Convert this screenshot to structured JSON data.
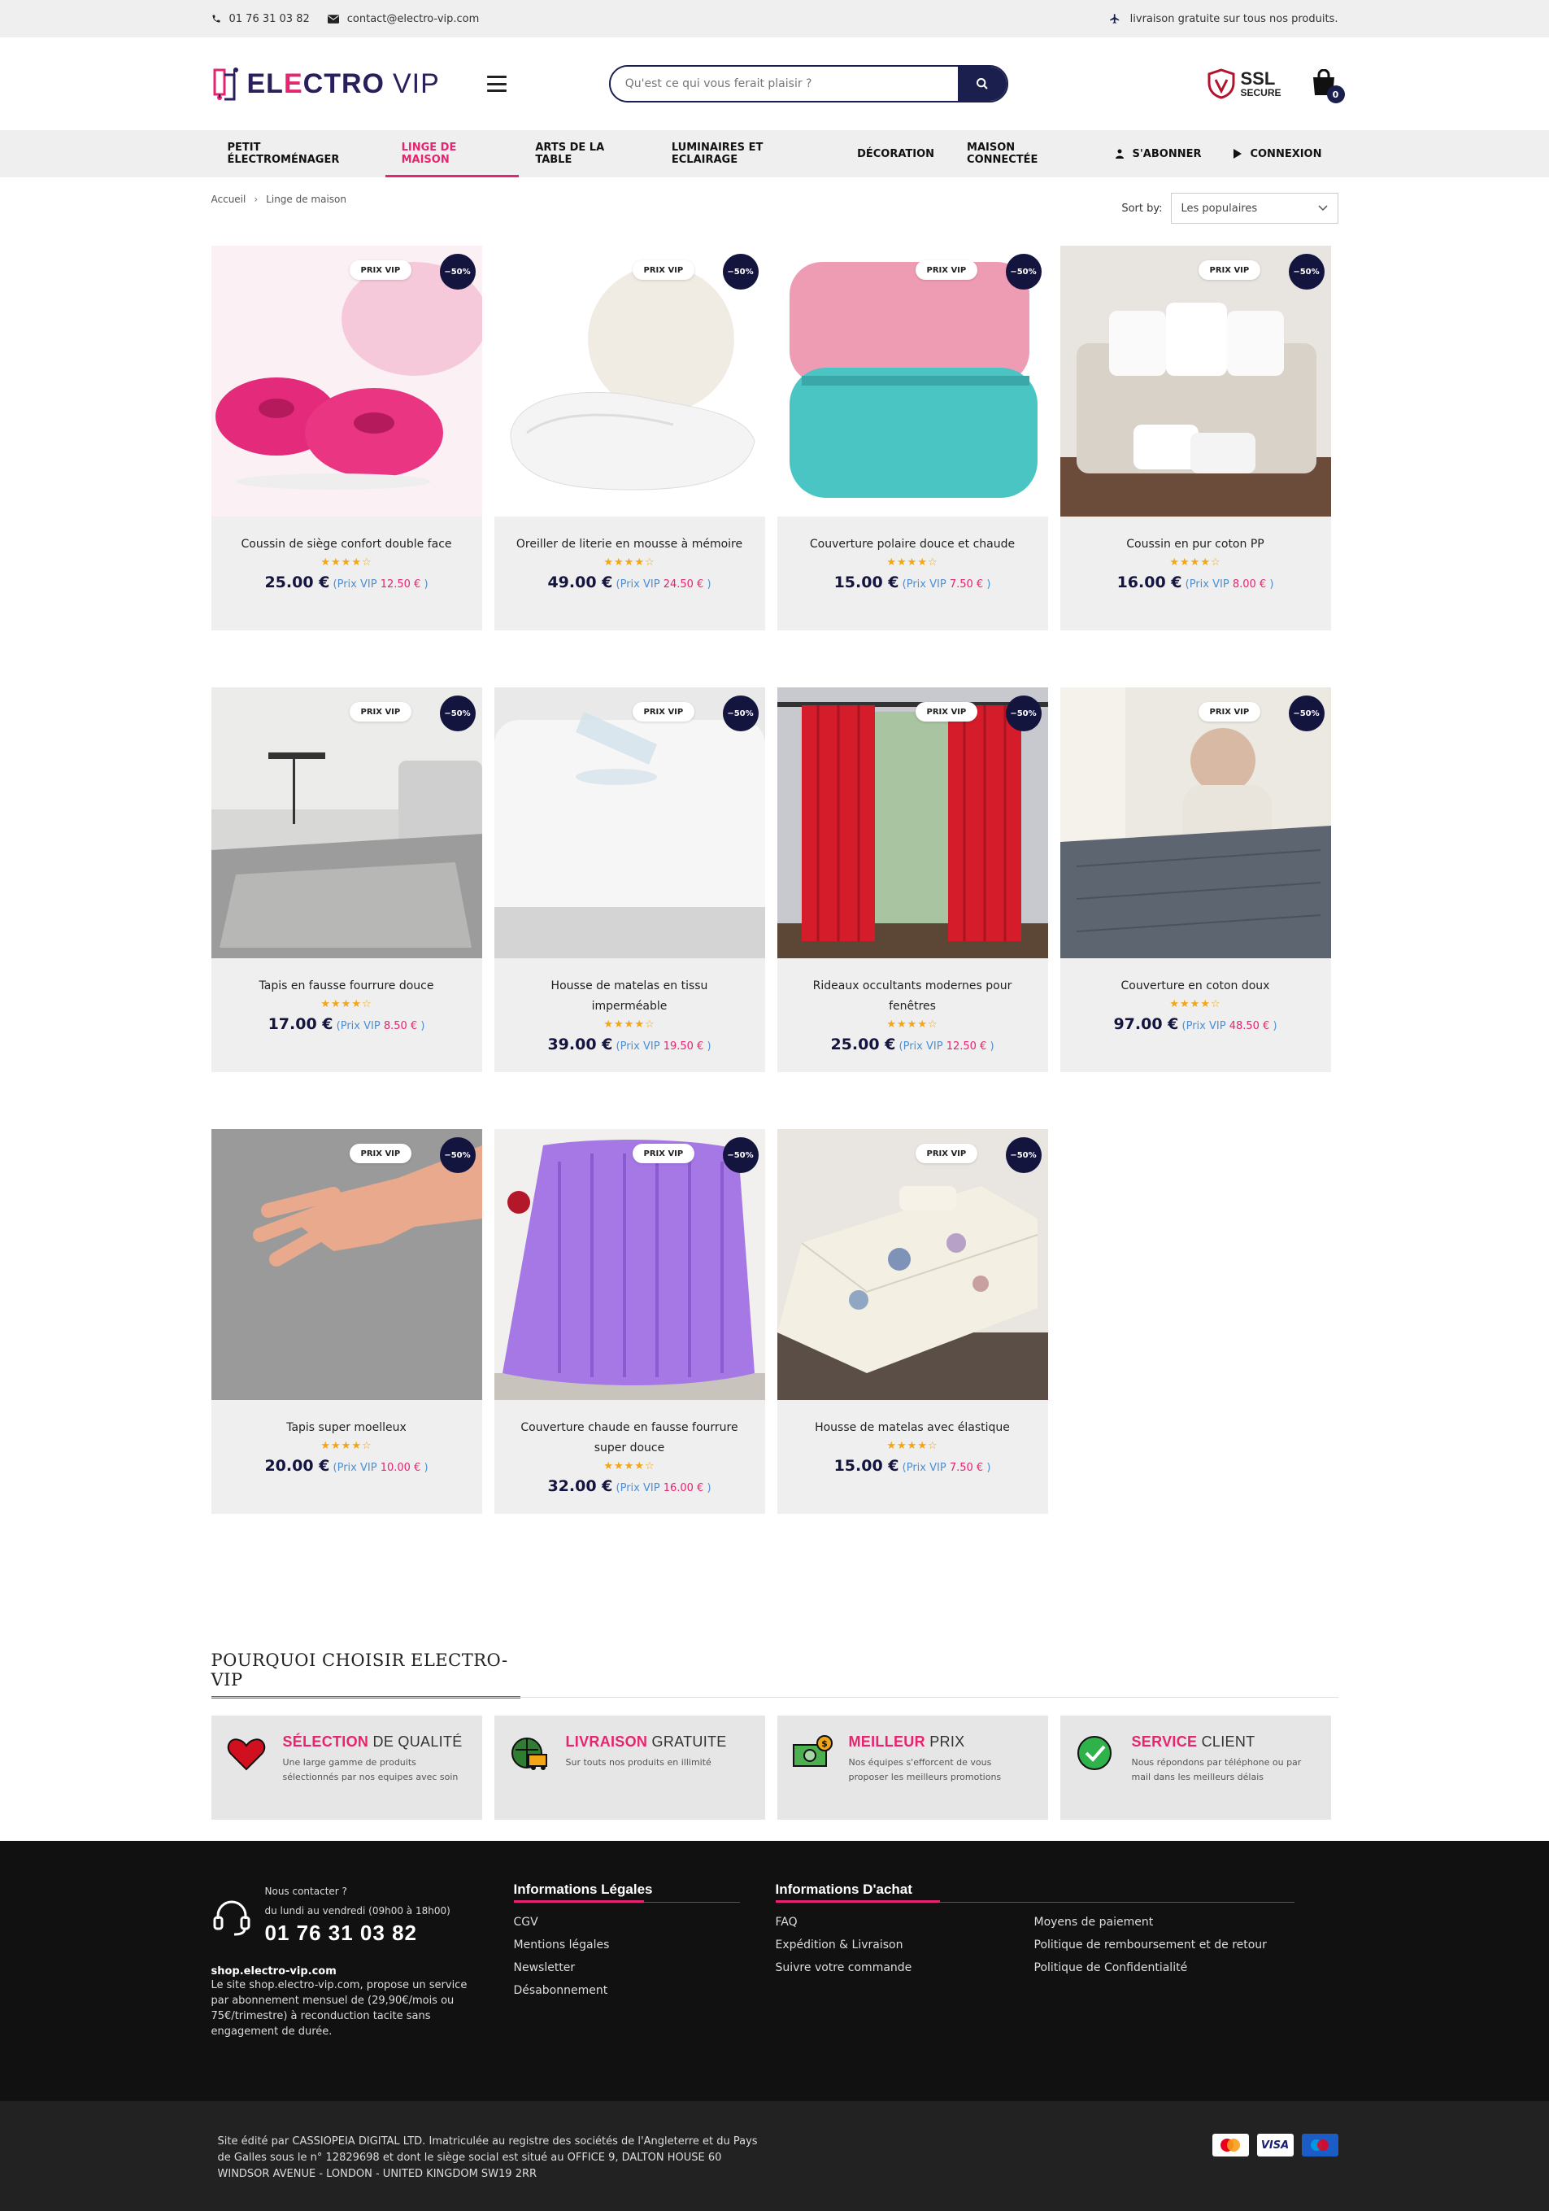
{
  "topbar": {
    "phone": "01 76 31 03 82",
    "email": "contact@electro-vip.com",
    "shipping": "livraison gratuite sur tous nos produits."
  },
  "header": {
    "brand_prefix": "EL",
    "brand_accent": "E",
    "brand_rest": "CTRO",
    "brand_vip": "VIP",
    "search_placeholder": "Qu'est ce qui vous ferait plaisir ?",
    "ssl_title": "SSL",
    "ssl_sub": "SECURE",
    "cart_count": "0"
  },
  "nav": {
    "items": [
      {
        "label": "Petit électroménager",
        "active": false
      },
      {
        "label": "Linge de maison",
        "active": true
      },
      {
        "label": "Arts de la table",
        "active": false
      },
      {
        "label": "Luminaires et Eclairage",
        "active": false
      },
      {
        "label": "Décoration",
        "active": false
      },
      {
        "label": "Maison connectée",
        "active": false
      }
    ],
    "subscribe": "S'abonner",
    "login": "Connexion"
  },
  "breadcrumb": {
    "home": "Accueil",
    "current": "Linge de maison"
  },
  "sort": {
    "label": "Sort by:",
    "value": "Les populaires"
  },
  "badges": {
    "vip": "PRIX VIP",
    "discount": "−50%"
  },
  "products": [
    {
      "name": "Coussin de siège confort double face",
      "price": "25.00 €",
      "vip_label": "(Prix VIP",
      "vip_price": "12.50 €",
      "close": ")",
      "stars": "★★★★☆",
      "rating": 4
    },
    {
      "name": "Oreiller de literie en mousse à mémoire",
      "price": "49.00 €",
      "vip_label": "(Prix VIP",
      "vip_price": "24.50 €",
      "close": ")",
      "stars": "★★★★☆",
      "rating": 4
    },
    {
      "name": "Couverture polaire douce et chaude",
      "price": "15.00 €",
      "vip_label": "(Prix VIP",
      "vip_price": "7.50 €",
      "close": ")",
      "stars": "★★★★☆",
      "rating": 4
    },
    {
      "name": "Coussin en pur coton PP",
      "price": "16.00 €",
      "vip_label": "(Prix VIP",
      "vip_price": "8.00 €",
      "close": ")",
      "stars": "★★★★☆",
      "rating": 4
    },
    {
      "name": "Tapis en fausse fourrure douce",
      "price": "17.00 €",
      "vip_label": "(Prix VIP",
      "vip_price": "8.50 €",
      "close": ")",
      "stars": "★★★★☆",
      "rating": 4
    },
    {
      "name": "Housse de matelas en tissu imperméable",
      "price": "39.00 €",
      "vip_label": "(Prix VIP",
      "vip_price": "19.50 €",
      "close": ")",
      "stars": "★★★★☆",
      "rating": 4
    },
    {
      "name": "Rideaux occultants modernes pour fenêtres",
      "price": "25.00 €",
      "vip_label": "(Prix VIP",
      "vip_price": "12.50 €",
      "close": ")",
      "stars": "★★★★☆",
      "rating": 4
    },
    {
      "name": "Couverture en coton doux",
      "price": "97.00 €",
      "vip_label": "(Prix VIP",
      "vip_price": "48.50 €",
      "close": ")",
      "stars": "★★★★☆",
      "rating": 4
    },
    {
      "name": "Tapis super moelleux",
      "price": "20.00 €",
      "vip_label": "(Prix VIP",
      "vip_price": "10.00 €",
      "close": ")",
      "stars": "★★★★☆",
      "rating": 4
    },
    {
      "name": "Couverture chaude en fausse fourrure super douce",
      "price": "32.00 €",
      "vip_label": "(Prix VIP",
      "vip_price": "16.00 €",
      "close": ")",
      "stars": "★★★★☆",
      "rating": 4
    },
    {
      "name": "Housse de matelas avec élastique",
      "price": "15.00 €",
      "vip_label": "(Prix VIP",
      "vip_price": "7.50 €",
      "close": ")",
      "stars": "★★★★☆",
      "rating": 4
    }
  ],
  "why": {
    "title_bold": "Pourquoi choisir",
    "title_rest": "ELECTRO-VIP",
    "features": [
      {
        "title": "Sélection",
        "rest": "de qualité",
        "text": "Une large gamme de produits sélectionnés par nos equipes avec soin"
      },
      {
        "title": "Livraison",
        "rest": "gratuite",
        "text": "Sur touts nos produits en illimité"
      },
      {
        "title": "Meilleur",
        "rest": "prix",
        "text": "Nos équipes s'efforcent de vous proposer les meilleurs promotions"
      },
      {
        "title": "Service",
        "rest": "client",
        "text": "Nous répondons par téléphone ou par mail dans les meilleurs délais"
      }
    ]
  },
  "footer": {
    "contact_q": "Nous contacter ?",
    "hours": "du lundi au vendredi (09h00 à 18h00)",
    "phone": "01 76 31 03 82",
    "shop": "shop.electro-vip.com",
    "desc": "Le site shop.electro-vip.com, propose un service par abonnement mensuel de (29,90€/mois ou 75€/trimestre) à reconduction tacite sans engagement de durée.",
    "legal_title": "Informations Légales",
    "legal_links": [
      "CGV",
      "Mentions légales",
      "Newsletter",
      "Désabonnement"
    ],
    "buy_title": "Informations D'achat",
    "buy_links_a": [
      "FAQ",
      "Expédition & Livraison",
      "Suivre votre commande"
    ],
    "buy_links_b": [
      "Moyens de paiement",
      "Politique de remboursement et de retour",
      "Politique de Confidentialité"
    ],
    "bottom_text": "Site édité par CASSIOPEIA DIGITAL LTD. Imatriculée au registre des sociétés de l'Angleterre et du Pays de Galles sous le n° 12829698 et dont le siège social est situé au OFFICE 9, DALTON HOUSE 60 WINDSOR AVENUE - LONDON - UNITED KINGDOM SW19 2RR",
    "cards": [
      "mastercard",
      "VISA",
      "maestro"
    ]
  },
  "colors": {
    "accent": "#e6246f",
    "navy": "#14153f"
  }
}
